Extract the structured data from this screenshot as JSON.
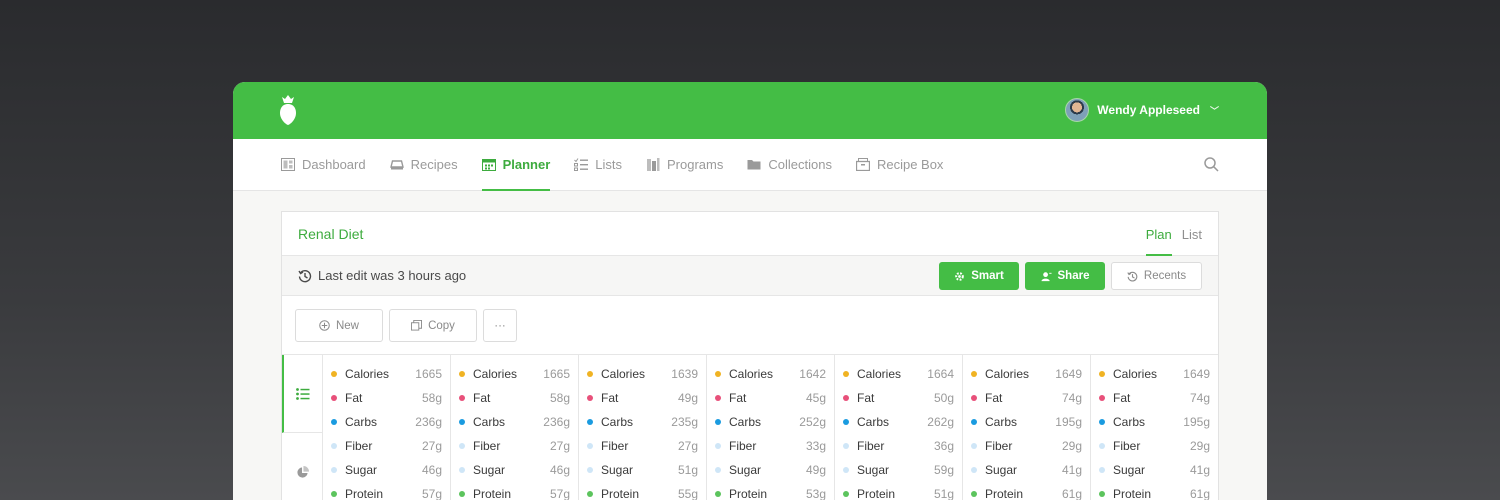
{
  "user": {
    "name": "Wendy Appleseed"
  },
  "nav": {
    "items": [
      {
        "label": "Dashboard",
        "icon": "dashboard-icon"
      },
      {
        "label": "Recipes",
        "icon": "recipes-icon"
      },
      {
        "label": "Planner",
        "icon": "calendar-icon",
        "active": true
      },
      {
        "label": "Lists",
        "icon": "list-icon"
      },
      {
        "label": "Programs",
        "icon": "programs-icon"
      },
      {
        "label": "Collections",
        "icon": "folder-icon"
      },
      {
        "label": "Recipe Box",
        "icon": "box-icon"
      }
    ]
  },
  "plan": {
    "title": "Renal Diet",
    "tabs": [
      {
        "label": "Plan",
        "active": true
      },
      {
        "label": "List"
      }
    ],
    "last_edit": "Last edit was 3 hours ago",
    "buttons": {
      "smart": "Smart",
      "share": "Share",
      "recents": "Recents"
    },
    "actions": {
      "new": "New",
      "copy": "Copy",
      "more": "···"
    }
  },
  "colors": {
    "brand": "#44bd45",
    "calories": "#f0b323",
    "fat": "#e8507a",
    "carbs": "#1a9be0",
    "fiber": "#cfe6f7",
    "sugar": "#cfe6f7",
    "protein": "#5cc45d"
  },
  "nutrient_labels": [
    "Calories",
    "Fat",
    "Carbs",
    "Fiber",
    "Sugar",
    "Protein"
  ],
  "days": [
    {
      "values": [
        "1665",
        "58g",
        "236g",
        "27g",
        "46g",
        "57g"
      ]
    },
    {
      "values": [
        "1665",
        "58g",
        "236g",
        "27g",
        "46g",
        "57g"
      ]
    },
    {
      "values": [
        "1639",
        "49g",
        "235g",
        "27g",
        "51g",
        "55g"
      ]
    },
    {
      "values": [
        "1642",
        "45g",
        "252g",
        "33g",
        "49g",
        "53g"
      ]
    },
    {
      "values": [
        "1664",
        "50g",
        "262g",
        "36g",
        "59g",
        "51g"
      ]
    },
    {
      "values": [
        "1649",
        "74g",
        "195g",
        "29g",
        "41g",
        "61g"
      ]
    },
    {
      "values": [
        "1649",
        "74g",
        "195g",
        "29g",
        "41g",
        "61g"
      ]
    }
  ]
}
